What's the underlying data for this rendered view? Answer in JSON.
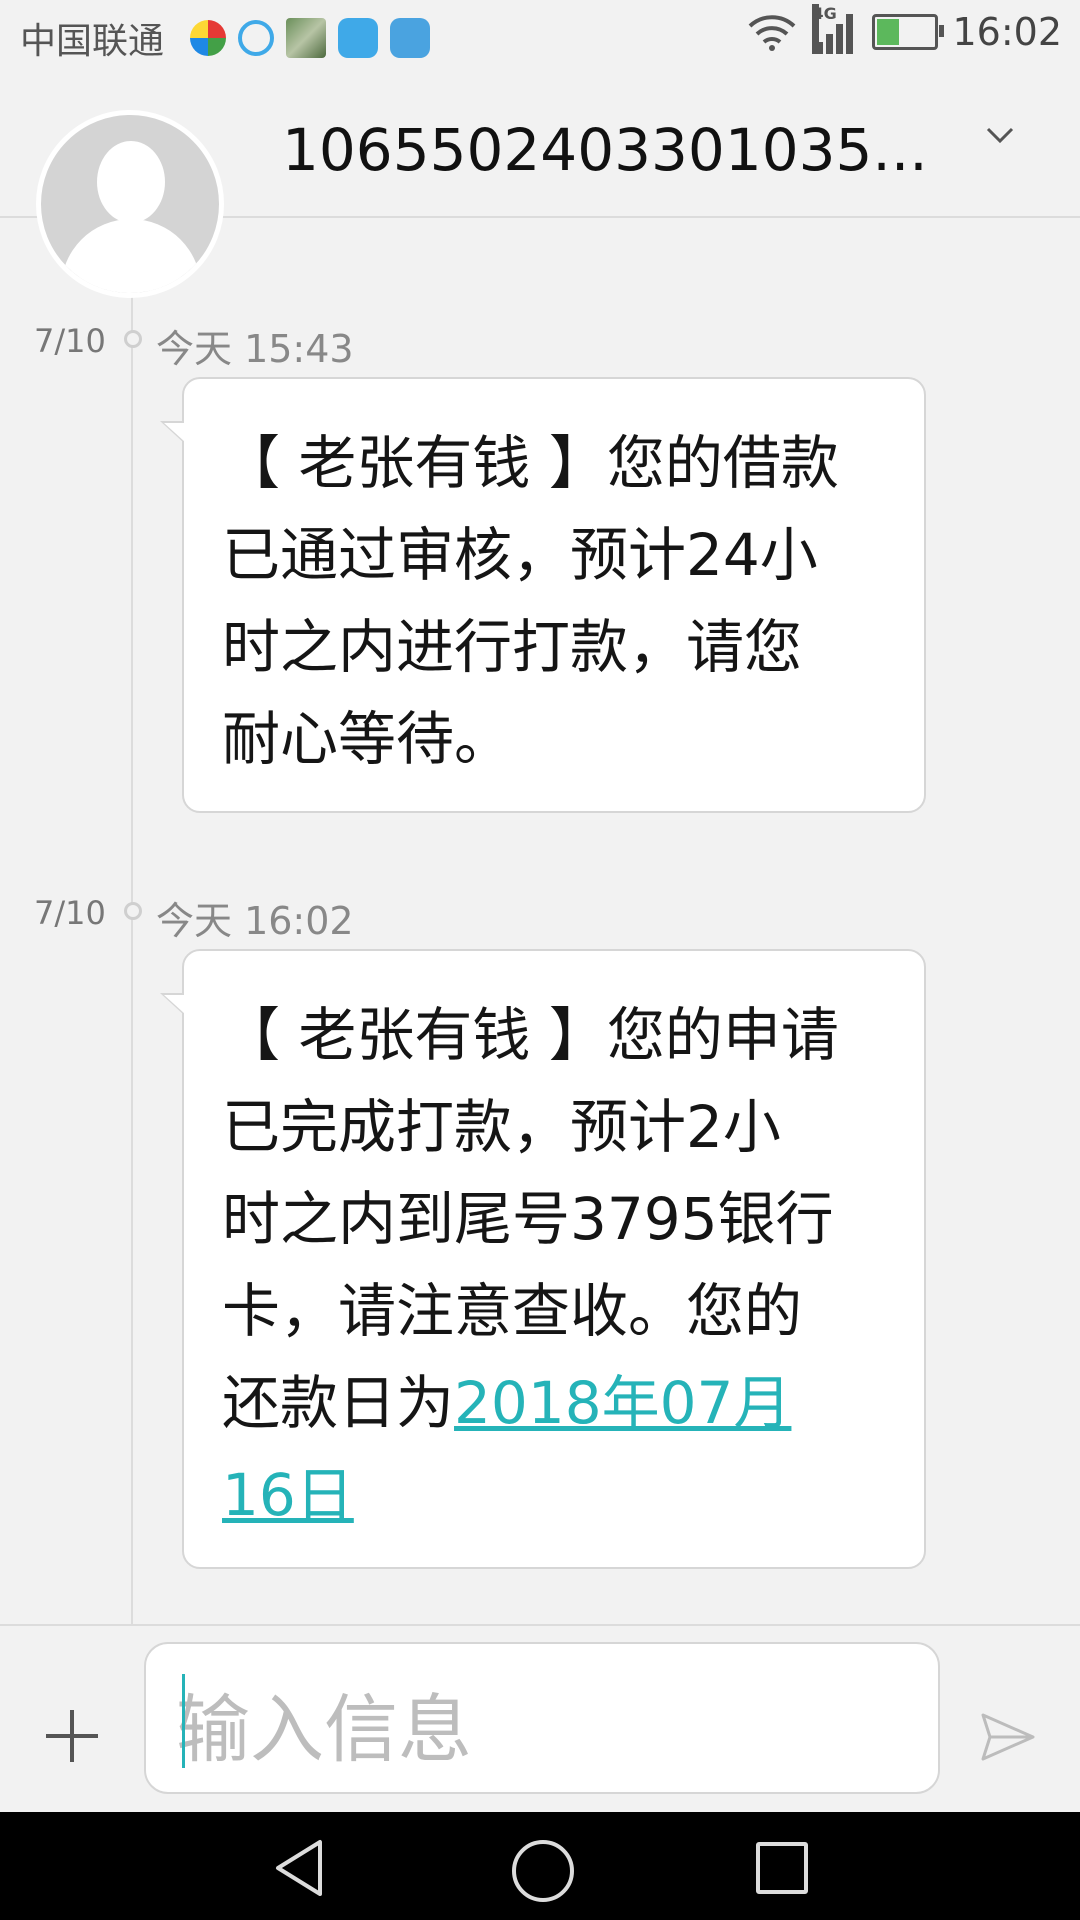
{
  "status_bar": {
    "carrier": "中国联通",
    "network": "4G",
    "time": "16:02"
  },
  "header": {
    "contact": "106550240330103​5..."
  },
  "messages": [
    {
      "date": "7/10",
      "time": "今天 15:43",
      "lines": [
        "【 老张有钱 】您的借款",
        "已通过审核，预计24小",
        "时之内进行打款，请您",
        "耐心等待。"
      ]
    },
    {
      "date": "7/10",
      "time": "今天 16:02",
      "lines": [
        "【 老张有钱 】您的申请",
        "已完成打款，预计2小",
        "时之内到尾号3795银行",
        "卡，请注意查收。您的"
      ],
      "last_prefix": "还款日为",
      "link_part1": "2018年07月",
      "link_part2": "16日"
    }
  ],
  "composer": {
    "placeholder": "输入信息"
  },
  "colors": {
    "accent": "#25b3b8",
    "background": "#f2f2f2"
  }
}
